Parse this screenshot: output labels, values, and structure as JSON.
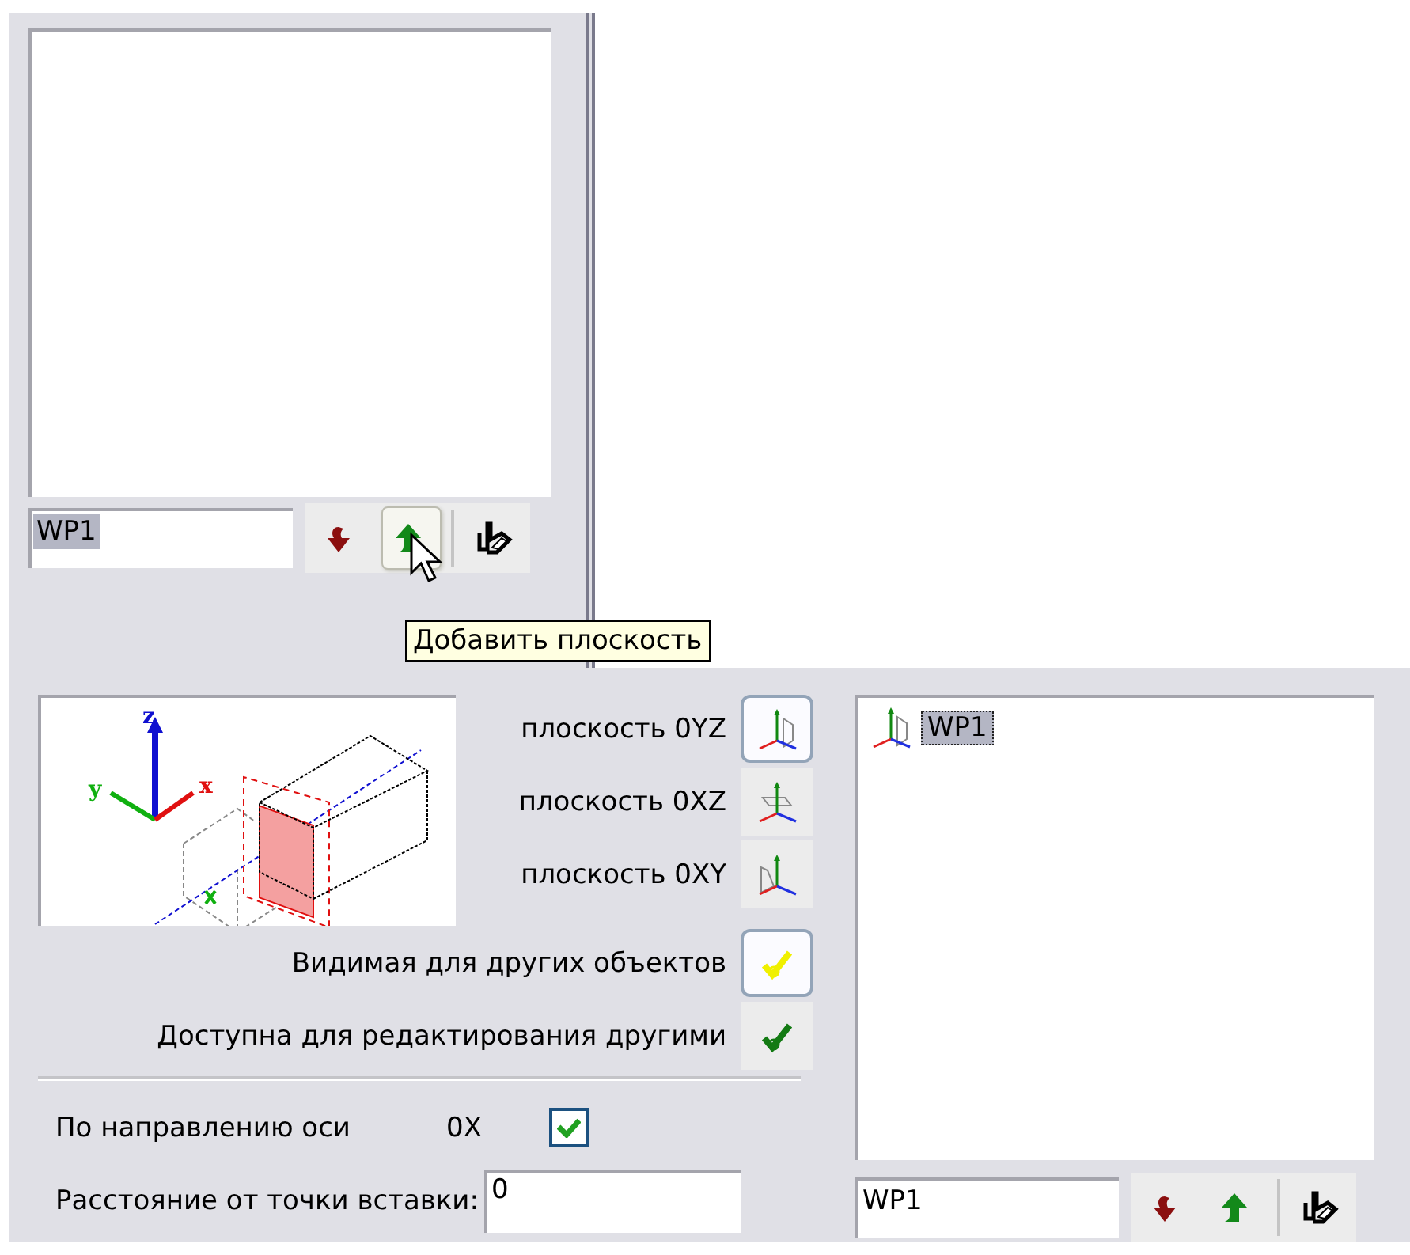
{
  "top_panel": {
    "name_field": {
      "value": "WP1",
      "text_selected": true
    },
    "toolbar": [
      {
        "kind": "down",
        "hovered": false
      },
      {
        "kind": "up",
        "hovered": true
      },
      {
        "kind": "erase",
        "hovered": false
      }
    ]
  },
  "tooltip": "Добавить плоскость",
  "preview": {
    "axis_labels": [
      "z",
      "y",
      "x"
    ]
  },
  "planes": [
    {
      "label": "плоскость 0YZ",
      "kind": "yz",
      "selected": true
    },
    {
      "label": "плоскость 0XZ",
      "kind": "xz",
      "selected": false
    },
    {
      "label": "плоскость 0XY",
      "kind": "xy",
      "selected": false
    }
  ],
  "options": [
    {
      "label": "Видимая для других объектов",
      "kind": "visible",
      "selected": true
    },
    {
      "label": "Доступна для редактирования другими",
      "kind": "editable",
      "selected": false
    }
  ],
  "direction": {
    "label": "По направлению оси",
    "axis": "0X",
    "checked": true
  },
  "distance": {
    "label": "Расстояние от точки вставки:",
    "value": "0"
  },
  "plane_list": {
    "items": [
      {
        "label": "WP1",
        "kind": "yz",
        "selected": true
      }
    ]
  },
  "bottom_panel": {
    "name_field": {
      "value": "WP1",
      "text_selected": false
    },
    "toolbar": [
      {
        "kind": "down",
        "hovered": false
      },
      {
        "kind": "up",
        "hovered": false
      },
      {
        "kind": "erase",
        "hovered": false
      }
    ]
  }
}
